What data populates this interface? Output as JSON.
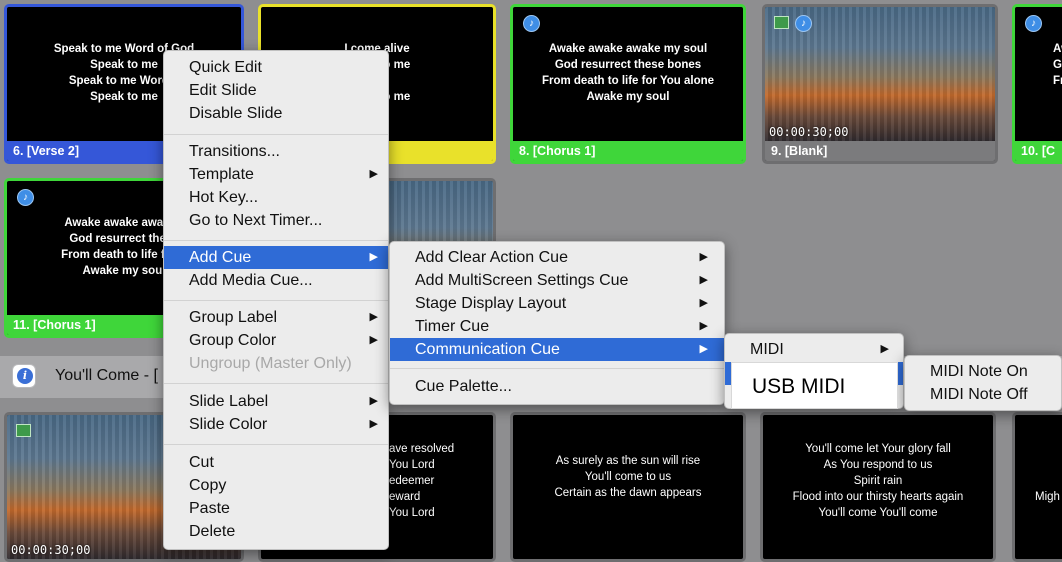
{
  "slides": {
    "verse2": {
      "lyrics": "Speak to me Word of God\nSpeak to me\nSpeak to me Word o\nSpeak to me",
      "label": "6. [Verse 2]"
    },
    "slide7": {
      "lyrics": "I come alive\n speak to me\nlive\n speak to me"
    },
    "chorus1_8": {
      "lyrics": "Awake awake awake my soul\nGod resurrect these bones\nFrom death to life for You alone\nAwake my soul",
      "label": "8. [Chorus 1]"
    },
    "blank": {
      "label": "9. [Blank]",
      "timecode": "00:00:30;00"
    },
    "slide10": {
      "lyrics": "Aw\nGo\nFro",
      "label": "10. [C"
    },
    "chorus1_11": {
      "lyrics": "Awake awake awake r\nGod resurrect these\nFrom death to life for Y\nAwake my soul",
      "label": "11. [Chorus 1]"
    },
    "bottom_video": {
      "timecode": "00:00:30;00"
    },
    "bottom2": {
      "lyrics": "ave resolved\nYou Lord\nedeemer\neward\nYou Lord"
    },
    "bottom3": {
      "lyrics": "As surely as the sun will rise\nYou'll come to us\nCertain as the dawn appears"
    },
    "bottom4": {
      "lyrics": "You'll come let Your glory fall\nAs You respond to us\nSpirit rain\nFlood into our thirsty hearts again\nYou'll come You'll come"
    },
    "bottom5": {
      "lyrics": "Migh"
    }
  },
  "group_bar": {
    "title": "You'll Come - ["
  },
  "context_menu": {
    "quick_edit": "Quick Edit",
    "edit_slide": "Edit Slide",
    "disable_slide": "Disable Slide",
    "transitions": "Transitions...",
    "template": "Template",
    "hot_key": "Hot Key...",
    "go_to_next_timer": "Go to Next Timer...",
    "add_cue": "Add Cue",
    "add_media_cue": "Add Media Cue...",
    "group_label": "Group Label",
    "group_color": "Group Color",
    "ungroup": "Ungroup (Master Only)",
    "slide_label": "Slide Label",
    "slide_color": "Slide Color",
    "cut": "Cut",
    "copy": "Copy",
    "paste": "Paste",
    "delete": "Delete"
  },
  "add_cue_menu": {
    "add_clear_action_cue": "Add Clear Action Cue",
    "add_multiscreen_settings_cue": "Add MultiScreen Settings Cue",
    "stage_display_layout": "Stage Display Layout",
    "timer_cue": "Timer Cue",
    "communication_cue": "Communication Cue",
    "cue_palette": "Cue Palette..."
  },
  "communication_menu": {
    "midi": "MIDI"
  },
  "midi_menu": {
    "note_on": "MIDI Note On",
    "note_off": "MIDI Note Off"
  },
  "tooltip": {
    "text": "USB MIDI"
  },
  "icons": {
    "submenu": "chevron-right-icon",
    "audio": "audio-cue-icon",
    "image": "image-cue-icon",
    "info": "info-icon"
  },
  "colors": {
    "selection": "#2f6bd6",
    "blue_label": "#3557d8",
    "yellow_label": "#e9e12a",
    "green_label": "#3fd63a"
  }
}
